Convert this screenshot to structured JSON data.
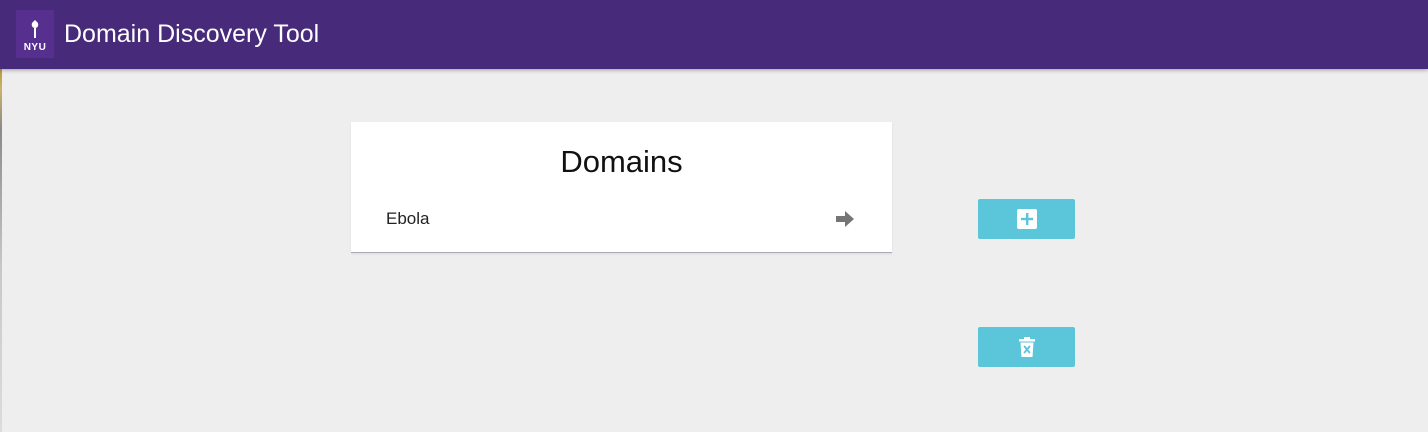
{
  "header": {
    "logo_text": "NYU",
    "title": "Domain Discovery Tool"
  },
  "domains_panel": {
    "title": "Domains",
    "items": [
      {
        "name": "Ebola",
        "action_icon": "arrow-right-icon"
      }
    ]
  },
  "actions": {
    "add_icon": "plus-square-icon",
    "delete_icon": "trash-x-icon"
  },
  "colors": {
    "appbar": "#482a7b",
    "logo_bg": "#57308f",
    "button": "#5bc5da",
    "background": "#eeeeee",
    "arrow_icon": "#757575"
  }
}
